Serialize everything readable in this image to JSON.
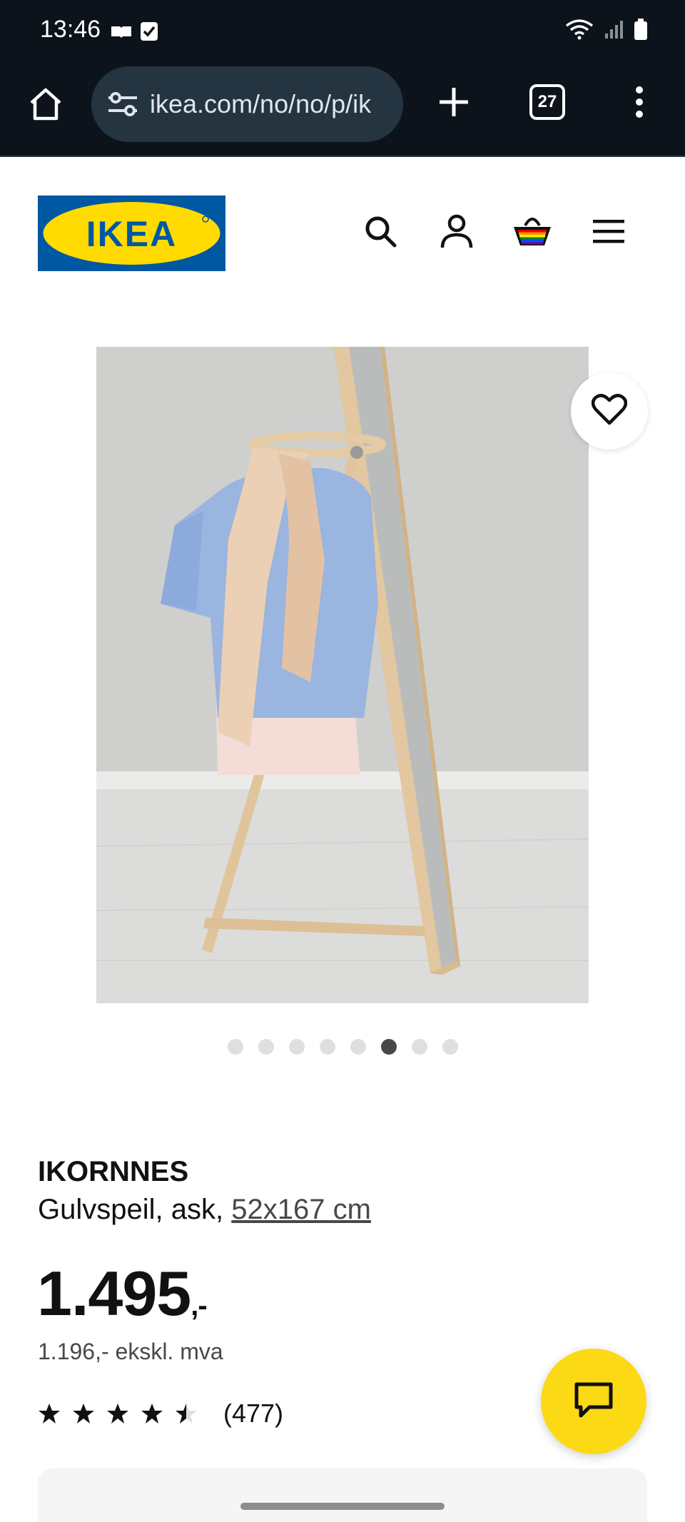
{
  "status_bar": {
    "time": "13:46",
    "left_icons": [
      "notification-icon",
      "checkbox-icon"
    ],
    "right_icons": [
      "wifi-icon",
      "signal-icon",
      "battery-icon"
    ]
  },
  "browser": {
    "url": "ikea.com/no/no/p/ik",
    "tab_count": "27",
    "icons": [
      "home-icon",
      "site-settings-icon",
      "plus-icon",
      "tabs-icon",
      "more-vert-icon"
    ]
  },
  "header": {
    "logo_text": "IKEA",
    "icons": [
      "search-icon",
      "account-icon",
      "basket-icon",
      "hamburger-menu-icon"
    ],
    "colors": {
      "logo_blue": "#0058a3",
      "logo_yellow": "#ffdb00"
    }
  },
  "gallery": {
    "dot_count": 8,
    "active_index": 5
  },
  "product": {
    "name": "IKORNNES",
    "description": "Gulvspeil, ask,",
    "size": "52x167 cm",
    "price_main": "1.495",
    "price_suffix": ",-",
    "price_excl_vat": "1.196,- ekskl. mva",
    "rating": 4.5,
    "review_count": "(477)"
  },
  "chat": {
    "icon": "chat-icon",
    "color": "#fbd914"
  }
}
